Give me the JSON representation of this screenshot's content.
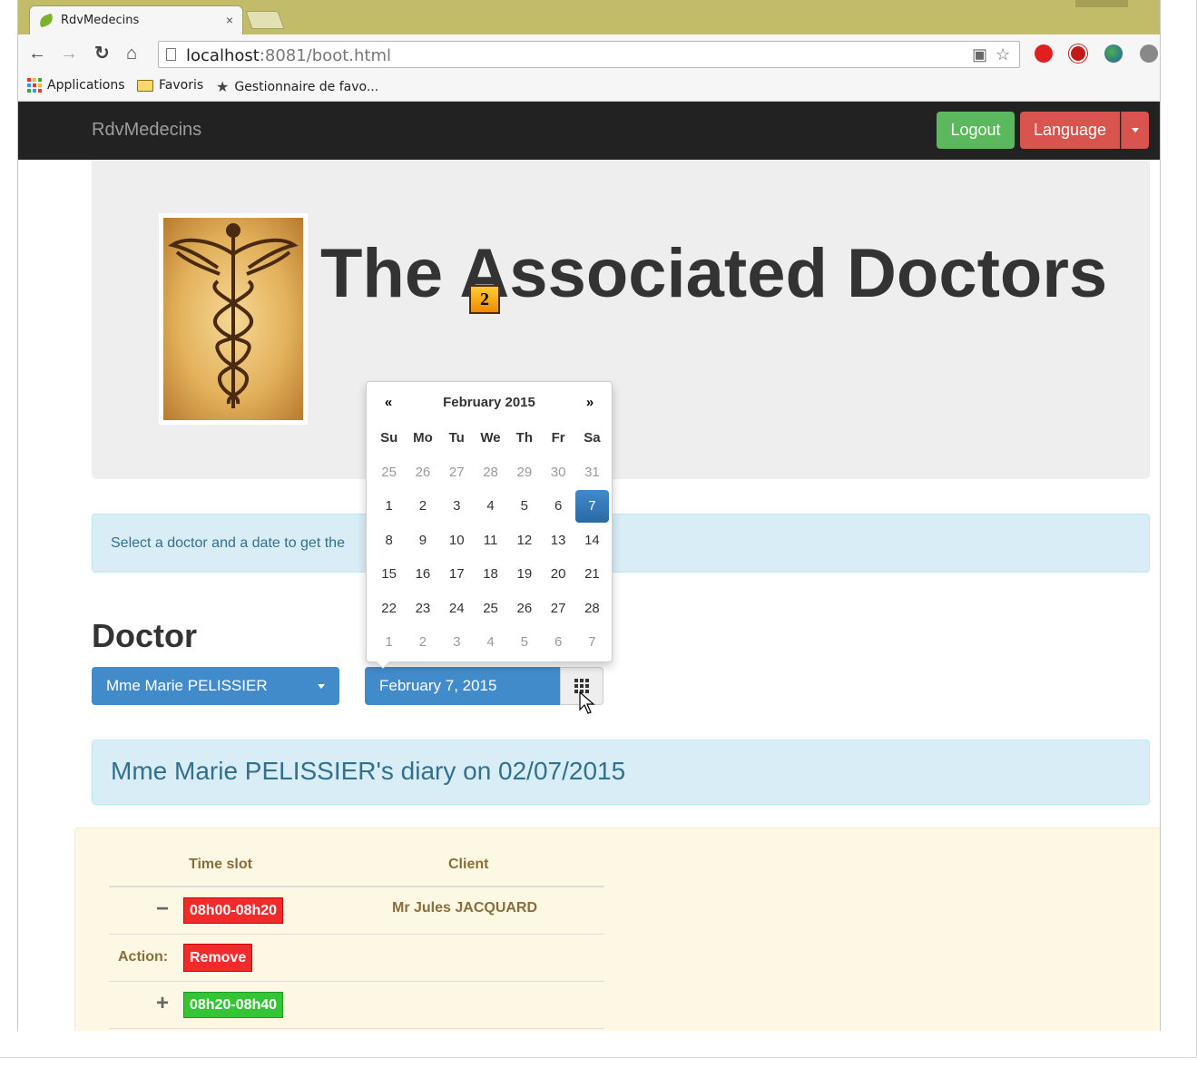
{
  "browser": {
    "tab_title": "RdvMedecins",
    "tab_close": "×",
    "url_host": "localhost",
    "url_rest": ":8081/boot.html",
    "bookmarks": [
      {
        "label": "Applications"
      },
      {
        "label": "Favoris"
      },
      {
        "label": "Gestionnaire de favo..."
      }
    ]
  },
  "navbar": {
    "brand": "RdvMedecins",
    "logout_label": "Logout",
    "language_label": "Language"
  },
  "jumbotron": {
    "title": "The Associated Doctors"
  },
  "marker": {
    "label": "2"
  },
  "alert": {
    "text": "Select a doctor and a date to get the"
  },
  "doctor_section": {
    "title": "Doctor",
    "selected_doctor": "Mme Marie PELISSIER",
    "selected_date": "February 7, 2015"
  },
  "datepicker": {
    "prev": "«",
    "next": "»",
    "month_title": "February 2015",
    "weekdays": [
      "Su",
      "Mo",
      "Tu",
      "We",
      "Th",
      "Fr",
      "Sa"
    ],
    "days": [
      {
        "d": "25",
        "old": true
      },
      {
        "d": "26",
        "old": true
      },
      {
        "d": "27",
        "old": true
      },
      {
        "d": "28",
        "old": true
      },
      {
        "d": "29",
        "old": true
      },
      {
        "d": "30",
        "old": true
      },
      {
        "d": "31",
        "old": true
      },
      {
        "d": "1"
      },
      {
        "d": "2"
      },
      {
        "d": "3"
      },
      {
        "d": "4"
      },
      {
        "d": "5"
      },
      {
        "d": "6"
      },
      {
        "d": "7",
        "active": true
      },
      {
        "d": "8"
      },
      {
        "d": "9"
      },
      {
        "d": "10"
      },
      {
        "d": "11"
      },
      {
        "d": "12"
      },
      {
        "d": "13"
      },
      {
        "d": "14"
      },
      {
        "d": "15"
      },
      {
        "d": "16"
      },
      {
        "d": "17"
      },
      {
        "d": "18"
      },
      {
        "d": "19"
      },
      {
        "d": "20"
      },
      {
        "d": "21"
      },
      {
        "d": "22"
      },
      {
        "d": "23"
      },
      {
        "d": "24"
      },
      {
        "d": "25"
      },
      {
        "d": "26"
      },
      {
        "d": "27"
      },
      {
        "d": "28"
      },
      {
        "d": "1",
        "old": true
      },
      {
        "d": "2",
        "old": true
      },
      {
        "d": "3",
        "old": true
      },
      {
        "d": "4",
        "old": true
      },
      {
        "d": "5",
        "old": true
      },
      {
        "d": "6",
        "old": true
      },
      {
        "d": "7",
        "old": true
      }
    ]
  },
  "diary": {
    "title": "Mme Marie PELISSIER's diary on 02/07/2015",
    "col_time_slot": "Time slot",
    "col_client": "Client",
    "rows": [
      {
        "sign": "−",
        "slot": "08h00-08h20",
        "client": "Mr Jules JACQUARD",
        "state": "booked"
      },
      {
        "action_label": "Action:",
        "action_button": "Remove"
      },
      {
        "sign": "+",
        "slot": "08h20-08h40",
        "state": "free"
      }
    ]
  },
  "colors": {
    "navbar_bg": "#222222",
    "primary": "#428bca",
    "success": "#5cb85c",
    "danger": "#d9534f",
    "info_bg": "#d9edf7",
    "warning_bg": "#fcf8e3"
  }
}
